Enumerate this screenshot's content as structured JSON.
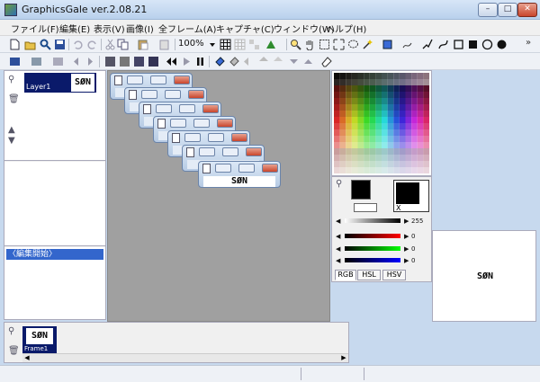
{
  "window": {
    "title": "GraphicsGale ver.2.08.21",
    "min_glyph": "–",
    "max_glyph": "□",
    "close_glyph": "✕"
  },
  "menu": [
    "ファイル(F)",
    "編集(E)",
    "表示(V)",
    "画像(I)",
    "全フレーム(A)",
    "キャプチャ(C)",
    "ウィンドウ(W)",
    "ヘルプ(H)"
  ],
  "toolbar": {
    "zoom": "100%",
    "more": "»"
  },
  "layers": [
    {
      "name": "Layer1",
      "thumb": "SØN"
    }
  ],
  "history": [
    "〈編集開始〉"
  ],
  "canvas_dialog_text": "SØN",
  "color": {
    "value_255": "255",
    "r": "0",
    "g": "0",
    "b": "0",
    "tabs": [
      "RGB",
      "HSL",
      "HSV"
    ],
    "x_label": "X"
  },
  "preview": {
    "text": "SØN"
  },
  "frames": [
    {
      "name": "Frame1",
      "thumb": "SØN"
    }
  ]
}
